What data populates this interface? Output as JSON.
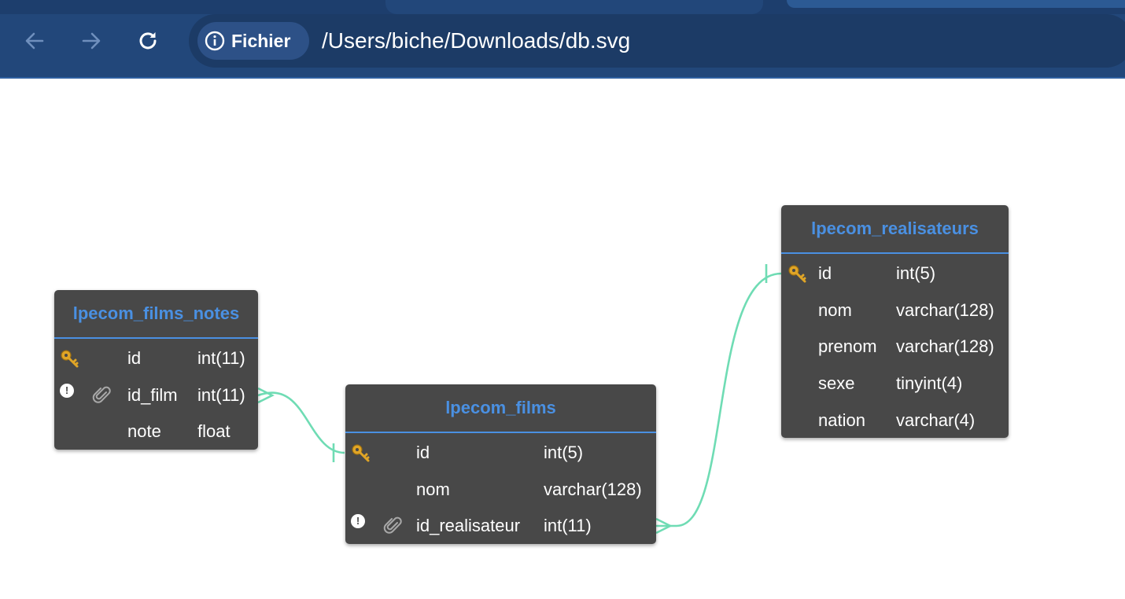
{
  "browser": {
    "back_icon": "arrow-left-icon",
    "forward_icon": "arrow-right-icon",
    "reload_icon": "reload-icon",
    "site_info_icon": "info-circle-icon",
    "site_info_label": "Fichier",
    "url": "/Users/biche/Downloads/db.svg",
    "colors": {
      "toolbar": "#22477a",
      "omnibox": "#1c3b66",
      "chip": "#2d5187"
    }
  },
  "diagram": {
    "colors": {
      "table_bg": "#484848",
      "title": "#4a90e2",
      "relation": "#6fdcb4"
    },
    "tables": [
      {
        "name": "lpecom_films_notes",
        "columns": [
          {
            "primary_key": true,
            "not_null": false,
            "foreign_key": false,
            "name": "id",
            "type": "int(11)"
          },
          {
            "primary_key": false,
            "not_null": true,
            "foreign_key": true,
            "name": "id_film",
            "type": "int(11)"
          },
          {
            "primary_key": false,
            "not_null": false,
            "foreign_key": false,
            "name": "note",
            "type": "float"
          }
        ]
      },
      {
        "name": "lpecom_films",
        "columns": [
          {
            "primary_key": true,
            "not_null": false,
            "foreign_key": false,
            "name": "id",
            "type": "int(5)"
          },
          {
            "primary_key": false,
            "not_null": false,
            "foreign_key": false,
            "name": "nom",
            "type": "varchar(128)"
          },
          {
            "primary_key": false,
            "not_null": true,
            "foreign_key": true,
            "name": "id_realisateur",
            "type": "int(11)"
          }
        ]
      },
      {
        "name": "lpecom_realisateurs",
        "columns": [
          {
            "primary_key": true,
            "not_null": false,
            "foreign_key": false,
            "name": "id",
            "type": "int(5)"
          },
          {
            "primary_key": false,
            "not_null": false,
            "foreign_key": false,
            "name": "nom",
            "type": "varchar(128)"
          },
          {
            "primary_key": false,
            "not_null": false,
            "foreign_key": false,
            "name": "prenom",
            "type": "varchar(128)"
          },
          {
            "primary_key": false,
            "not_null": false,
            "foreign_key": false,
            "name": "sexe",
            "type": "tinyint(4)"
          },
          {
            "primary_key": false,
            "not_null": false,
            "foreign_key": false,
            "name": "nation",
            "type": "varchar(4)"
          }
        ]
      }
    ],
    "relations": [
      {
        "from": "lpecom_films_notes.id_film",
        "to": "lpecom_films.id",
        "from_end": "many",
        "to_end": "one"
      },
      {
        "from": "lpecom_films.id_realisateur",
        "to": "lpecom_realisateurs.id",
        "from_end": "many",
        "to_end": "one"
      }
    ],
    "not_null_marker": "!"
  }
}
